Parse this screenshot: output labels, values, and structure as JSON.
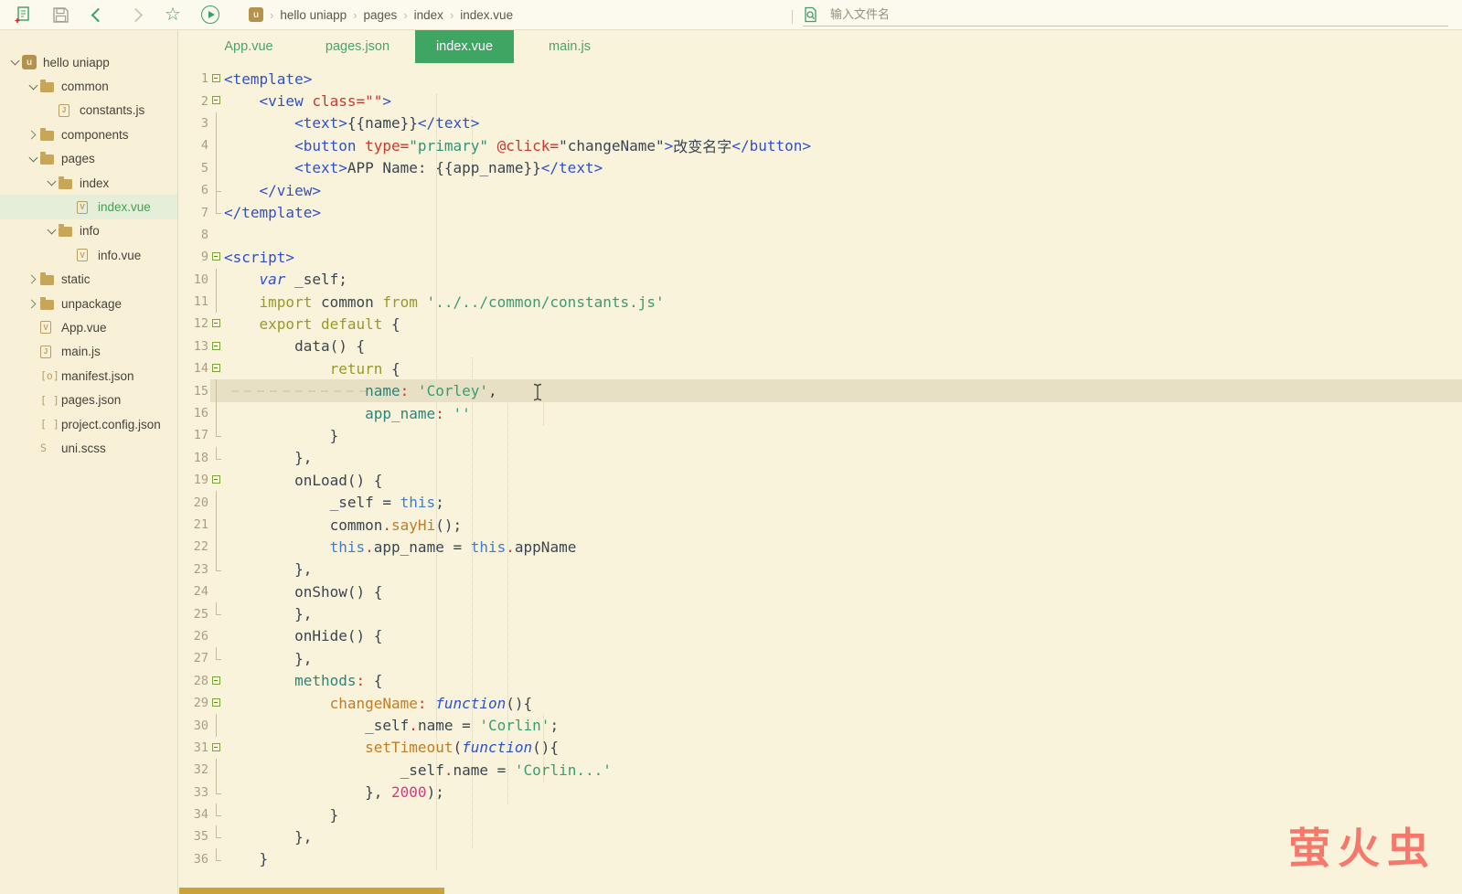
{
  "toolbar": {
    "icons": [
      "new-file",
      "save",
      "navigate-back",
      "navigate-forward",
      "favorite",
      "run"
    ],
    "breadcrumb": {
      "items": [
        "hello uniapp",
        "pages",
        "index",
        "index.vue"
      ]
    },
    "search": {
      "placeholder": "输入文件名"
    }
  },
  "sidebar": {
    "tree": [
      {
        "label": "hello uniapp",
        "indent": 0,
        "chevron": "down",
        "icon": "logo",
        "glyph": "u",
        "selected": false
      },
      {
        "label": "common",
        "indent": 1,
        "chevron": "down",
        "icon": "folder",
        "glyph": "",
        "selected": false
      },
      {
        "label": "constants.js",
        "indent": 2,
        "chevron": "none",
        "icon": "doc",
        "glyph": "J",
        "selected": false
      },
      {
        "label": "components",
        "indent": 1,
        "chevron": "right",
        "icon": "folder",
        "glyph": "",
        "selected": false
      },
      {
        "label": "pages",
        "indent": 1,
        "chevron": "down",
        "icon": "folder",
        "glyph": "",
        "selected": false
      },
      {
        "label": "index",
        "indent": 2,
        "chevron": "down",
        "icon": "folder",
        "glyph": "",
        "selected": false
      },
      {
        "label": "index.vue",
        "indent": 3,
        "chevron": "none",
        "icon": "doc",
        "glyph": "V",
        "selected": true
      },
      {
        "label": "info",
        "indent": 2,
        "chevron": "down",
        "icon": "folder",
        "glyph": "",
        "selected": false
      },
      {
        "label": "info.vue",
        "indent": 3,
        "chevron": "none",
        "icon": "doc",
        "glyph": "V",
        "selected": false
      },
      {
        "label": "static",
        "indent": 1,
        "chevron": "right",
        "icon": "folder",
        "glyph": "",
        "selected": false
      },
      {
        "label": "unpackage",
        "indent": 1,
        "chevron": "right",
        "icon": "folder",
        "glyph": "",
        "selected": false
      },
      {
        "label": "App.vue",
        "indent": 1,
        "chevron": "none",
        "icon": "doc",
        "glyph": "V",
        "selected": false
      },
      {
        "label": "main.js",
        "indent": 1,
        "chevron": "none",
        "icon": "doc",
        "glyph": "J",
        "selected": false
      },
      {
        "label": "manifest.json",
        "indent": 1,
        "chevron": "none",
        "icon": "glyph",
        "glyph": "[o]",
        "selected": false
      },
      {
        "label": "pages.json",
        "indent": 1,
        "chevron": "none",
        "icon": "glyph",
        "glyph": "[ ]",
        "selected": false
      },
      {
        "label": "project.config.json",
        "indent": 1,
        "chevron": "none",
        "icon": "glyph",
        "glyph": "[ ]",
        "selected": false
      },
      {
        "label": "uni.scss",
        "indent": 1,
        "chevron": "none",
        "icon": "glyph",
        "glyph": "S",
        "selected": false
      }
    ]
  },
  "tabs": [
    {
      "label": "App.vue",
      "active": false
    },
    {
      "label": "pages.json",
      "active": false
    },
    {
      "label": "index.vue",
      "active": true
    },
    {
      "label": "main.js",
      "active": false
    }
  ],
  "editor": {
    "lines": [
      {
        "n": 1,
        "fold": "box",
        "hl": false,
        "segs": [
          [
            "tag",
            "<template>"
          ]
        ]
      },
      {
        "n": 2,
        "fold": "box",
        "hl": false,
        "segs": [
          [
            "pln",
            "    "
          ],
          [
            "tag",
            "<view"
          ],
          [
            "red",
            " class=\"\""
          ],
          [
            "tag",
            ">"
          ]
        ]
      },
      {
        "n": 3,
        "fold": "vline",
        "hl": false,
        "segs": [
          [
            "pln",
            "        "
          ],
          [
            "tag",
            "<text>"
          ],
          [
            "pln",
            "{{name}}"
          ],
          [
            "tag",
            "</text>"
          ]
        ]
      },
      {
        "n": 4,
        "fold": "vline",
        "hl": false,
        "segs": [
          [
            "pln",
            "        "
          ],
          [
            "tag",
            "<button"
          ],
          [
            "red",
            " type="
          ],
          [
            "val",
            "\"primary\""
          ],
          [
            "red",
            " @click="
          ],
          [
            "pln",
            "\"changeName\""
          ],
          [
            "tag",
            ">"
          ],
          [
            "pln",
            "改变名字"
          ],
          [
            "tag",
            "</button>"
          ]
        ]
      },
      {
        "n": 5,
        "fold": "vline",
        "hl": false,
        "segs": [
          [
            "pln",
            "        "
          ],
          [
            "tag",
            "<text>"
          ],
          [
            "pln",
            "APP Name: {{app_name}}"
          ],
          [
            "tag",
            "</text>"
          ]
        ]
      },
      {
        "n": 6,
        "fold": "tee",
        "hl": false,
        "segs": [
          [
            "pln",
            "    "
          ],
          [
            "tag",
            "</view>"
          ]
        ]
      },
      {
        "n": 7,
        "fold": "end",
        "hl": false,
        "segs": [
          [
            "tag",
            "</template>"
          ]
        ]
      },
      {
        "n": 8,
        "fold": "",
        "hl": false,
        "segs": []
      },
      {
        "n": 9,
        "fold": "box",
        "hl": false,
        "segs": [
          [
            "tag",
            "<script>"
          ]
        ]
      },
      {
        "n": 10,
        "fold": "vline",
        "hl": false,
        "segs": [
          [
            "pln",
            "    "
          ],
          [
            "kw2",
            "var"
          ],
          [
            "pln",
            " _self;"
          ]
        ]
      },
      {
        "n": 11,
        "fold": "vline",
        "hl": false,
        "segs": [
          [
            "pln",
            "    "
          ],
          [
            "kw",
            "import"
          ],
          [
            "pln",
            " common "
          ],
          [
            "kw",
            "from"
          ],
          [
            "str",
            " '../../common/constants.js'"
          ]
        ]
      },
      {
        "n": 12,
        "fold": "box",
        "hl": false,
        "segs": [
          [
            "pln",
            "    "
          ],
          [
            "kw",
            "export"
          ],
          [
            "pln",
            " "
          ],
          [
            "kw",
            "default"
          ],
          [
            "pln",
            " {"
          ]
        ]
      },
      {
        "n": 13,
        "fold": "box",
        "hl": false,
        "segs": [
          [
            "pln",
            "        data() {"
          ]
        ]
      },
      {
        "n": 14,
        "fold": "box",
        "hl": false,
        "segs": [
          [
            "pln",
            "            "
          ],
          [
            "kw",
            "return"
          ],
          [
            "pln",
            " {"
          ]
        ]
      },
      {
        "n": 15,
        "fold": "vline",
        "hl": true,
        "segs": [
          [
            "pln",
            "                "
          ],
          [
            "prop",
            "name"
          ],
          [
            "red",
            ":"
          ],
          [
            "str",
            " 'Corley'"
          ],
          [
            "pln",
            ","
          ]
        ]
      },
      {
        "n": 16,
        "fold": "vline",
        "hl": false,
        "segs": [
          [
            "pln",
            "                "
          ],
          [
            "prop",
            "app_name"
          ],
          [
            "red",
            ":"
          ],
          [
            "str",
            " ''"
          ]
        ]
      },
      {
        "n": 17,
        "fold": "end",
        "hl": false,
        "segs": [
          [
            "pln",
            "            }"
          ]
        ]
      },
      {
        "n": 18,
        "fold": "end",
        "hl": false,
        "segs": [
          [
            "pln",
            "        },"
          ]
        ]
      },
      {
        "n": 19,
        "fold": "box",
        "hl": false,
        "segs": [
          [
            "pln",
            "        onLoad() {"
          ]
        ]
      },
      {
        "n": 20,
        "fold": "vline",
        "hl": false,
        "segs": [
          [
            "pln",
            "            _self = "
          ],
          [
            "kw3",
            "this"
          ],
          [
            "pln",
            ";"
          ]
        ]
      },
      {
        "n": 21,
        "fold": "vline",
        "hl": false,
        "segs": [
          [
            "pln",
            "            common"
          ],
          [
            "red",
            "."
          ],
          [
            "fn",
            "sayHi"
          ],
          [
            "pln",
            "();"
          ]
        ]
      },
      {
        "n": 22,
        "fold": "vline",
        "hl": false,
        "segs": [
          [
            "pln",
            "            "
          ],
          [
            "kw3",
            "this"
          ],
          [
            "red",
            "."
          ],
          [
            "pln",
            "app_name = "
          ],
          [
            "kw3",
            "this"
          ],
          [
            "red",
            "."
          ],
          [
            "pln",
            "appName"
          ]
        ]
      },
      {
        "n": 23,
        "fold": "end",
        "hl": false,
        "segs": [
          [
            "pln",
            "        },"
          ]
        ]
      },
      {
        "n": 24,
        "fold": "",
        "hl": false,
        "segs": [
          [
            "pln",
            "        onShow() {"
          ]
        ]
      },
      {
        "n": 25,
        "fold": "end",
        "hl": false,
        "segs": [
          [
            "pln",
            "        },"
          ]
        ]
      },
      {
        "n": 26,
        "fold": "",
        "hl": false,
        "segs": [
          [
            "pln",
            "        onHide() {"
          ]
        ]
      },
      {
        "n": 27,
        "fold": "end",
        "hl": false,
        "segs": [
          [
            "pln",
            "        },"
          ]
        ]
      },
      {
        "n": 28,
        "fold": "box",
        "hl": false,
        "segs": [
          [
            "pln",
            "        "
          ],
          [
            "prop",
            "methods"
          ],
          [
            "red",
            ":"
          ],
          [
            "pln",
            " {"
          ]
        ]
      },
      {
        "n": 29,
        "fold": "box",
        "hl": false,
        "segs": [
          [
            "pln",
            "            "
          ],
          [
            "fn",
            "changeName"
          ],
          [
            "red",
            ":"
          ],
          [
            "pln",
            " "
          ],
          [
            "kw2",
            "function"
          ],
          [
            "pln",
            "(){"
          ]
        ]
      },
      {
        "n": 30,
        "fold": "vline",
        "hl": false,
        "segs": [
          [
            "pln",
            "                _self"
          ],
          [
            "red",
            "."
          ],
          [
            "pln",
            "name = "
          ],
          [
            "str",
            "'Corlin'"
          ],
          [
            "pln",
            ";"
          ]
        ]
      },
      {
        "n": 31,
        "fold": "box",
        "hl": false,
        "segs": [
          [
            "pln",
            "                "
          ],
          [
            "fn",
            "setTimeout"
          ],
          [
            "pln",
            "("
          ],
          [
            "kw2",
            "function"
          ],
          [
            "pln",
            "(){"
          ]
        ]
      },
      {
        "n": 32,
        "fold": "vline",
        "hl": false,
        "segs": [
          [
            "pln",
            "                    _self"
          ],
          [
            "red",
            "."
          ],
          [
            "pln",
            "name = "
          ],
          [
            "str",
            "'Corlin...'"
          ]
        ]
      },
      {
        "n": 33,
        "fold": "end",
        "hl": false,
        "segs": [
          [
            "pln",
            "                }, "
          ],
          [
            "num",
            "2000"
          ],
          [
            "pln",
            ");"
          ]
        ]
      },
      {
        "n": 34,
        "fold": "end",
        "hl": false,
        "segs": [
          [
            "pln",
            "            }"
          ]
        ]
      },
      {
        "n": 35,
        "fold": "end",
        "hl": false,
        "segs": [
          [
            "pln",
            "        },"
          ]
        ]
      },
      {
        "n": 36,
        "fold": "end",
        "hl": false,
        "segs": [
          [
            "pln",
            "    }"
          ]
        ]
      }
    ]
  },
  "watermark": {
    "text": "萤火虫"
  },
  "colors": {
    "editor_bg": "#faf3db",
    "active_tab_green": "#3ea563",
    "tree_selection_bg": "#e4eed9",
    "tree_selection_text": "#43a052",
    "line_highlight": "#e8e0c5",
    "scrollbar_gold": "#c9a23c",
    "watermark_coral": "#f4796c"
  }
}
